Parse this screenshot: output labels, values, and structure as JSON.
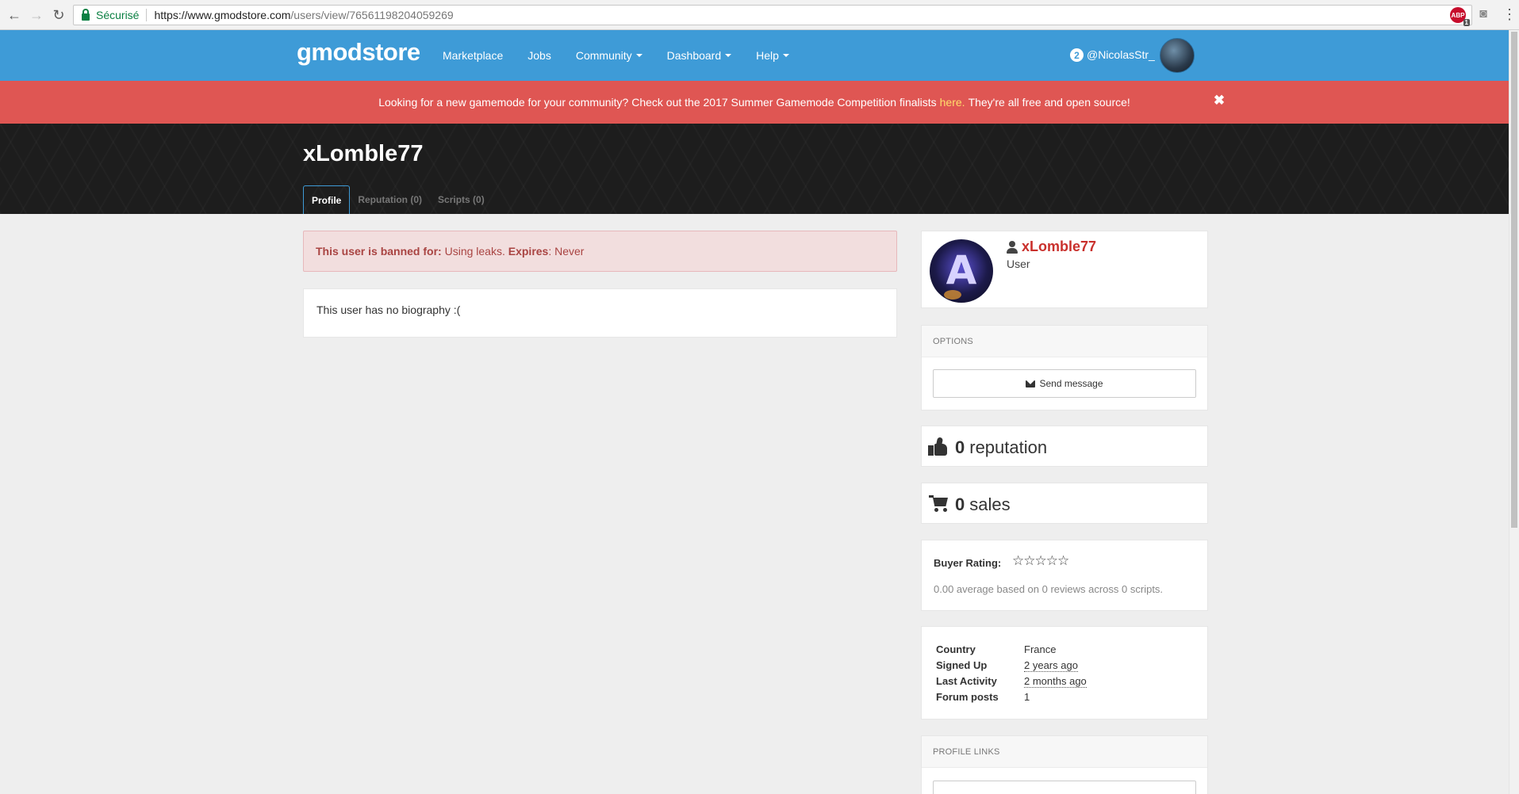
{
  "browser": {
    "secure_label": "Sécurisé",
    "url_host": "https://www.gmodstore.com",
    "url_path": "/users/view/76561198204059269",
    "extension_badge": "ABP",
    "extension_count": "1"
  },
  "header": {
    "logo": "gmodstore",
    "nav": [
      {
        "label": "Marketplace",
        "dropdown": false
      },
      {
        "label": "Jobs",
        "dropdown": false
      },
      {
        "label": "Community",
        "dropdown": true
      },
      {
        "label": "Dashboard",
        "dropdown": true
      },
      {
        "label": "Help",
        "dropdown": true
      }
    ],
    "notification_count": "2",
    "username": "@NicolasStr_"
  },
  "alert": {
    "text": "Looking for a new gamemode for your community? Check out the 2017 Summer Gamemode Competition finalists",
    "link": "here.",
    "text_after": "They're all free and open source!",
    "close": "✖"
  },
  "profile": {
    "title": "xLomble77",
    "tabs": [
      {
        "label": "Profile",
        "active": true
      },
      {
        "label": "Reputation (0)",
        "active": false
      },
      {
        "label": "Scripts (0)",
        "active": false
      }
    ]
  },
  "ban": {
    "label": "This user is banned for:",
    "reason": "Using leaks.",
    "expires_label": "Expires",
    "expires_value": ": Never"
  },
  "bio": {
    "text": "This user has no biography :("
  },
  "user_card": {
    "name": "xLomble77",
    "role": "User"
  },
  "options": {
    "heading": "OPTIONS",
    "send_message": "Send message"
  },
  "stats": {
    "reputation_value": "0",
    "reputation_label": "reputation",
    "sales_value": "0",
    "sales_label": "sales"
  },
  "rating": {
    "label": "Buyer Rating:",
    "stars_filled": 0,
    "stars_total": 5,
    "summary": "0.00 average based on 0 reviews across 0 scripts."
  },
  "info": [
    {
      "key": "Country",
      "value": "France",
      "dotted": false
    },
    {
      "key": "Signed Up",
      "value": "2 years ago",
      "dotted": true
    },
    {
      "key": "Last Activity",
      "value": "2 months ago",
      "dotted": true
    },
    {
      "key": "Forum posts",
      "value": "1",
      "dotted": false
    }
  ],
  "links": {
    "heading": "PROFILE LINKS"
  },
  "colors": {
    "header_blue": "#3e9bd7",
    "alert_red": "#df5653",
    "ban_bg": "#f2dede",
    "ban_text": "#a94442",
    "name_red": "#c9302c"
  }
}
